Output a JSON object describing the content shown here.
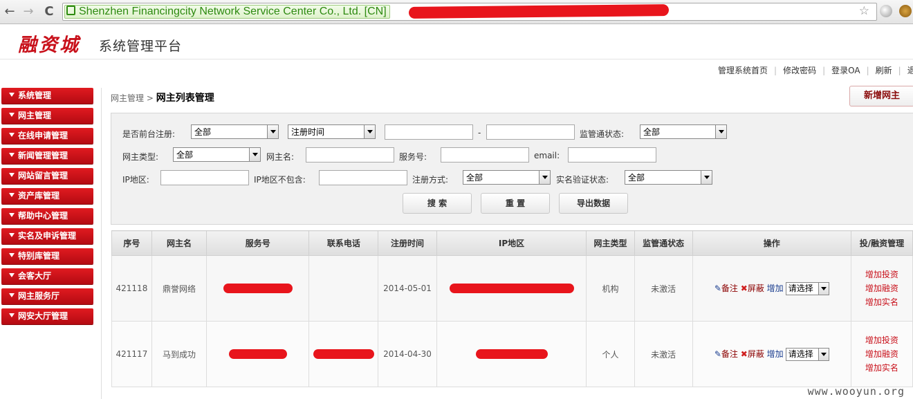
{
  "browser": {
    "ev_label": "Shenzhen Financingcity Network Service Center Co., Ltd. [CN]",
    "back_icon": "←",
    "forward_icon": "→",
    "reload_icon": "C",
    "star_icon": "☆"
  },
  "header": {
    "logo": "融资城",
    "system_title": "系统管理平台"
  },
  "topnav": {
    "links": [
      "管理系统首页",
      "修改密码",
      "登录OA",
      "刷新",
      "退"
    ]
  },
  "sidebar": {
    "items": [
      "系统管理",
      "网主管理",
      "在线申请管理",
      "新闻管理管理",
      "网站留言管理",
      "资产库管理",
      "帮助中心管理",
      "实名及申诉管理",
      "特别库管理",
      "会客大厅",
      "网主服务厅",
      "网安大厅管理"
    ]
  },
  "breadcrumb": {
    "parent": "网主管理",
    "separator": ">",
    "current": "网主列表管理"
  },
  "add_button": "新增网主",
  "filters": {
    "front_register_label": "是否前台注册:",
    "front_register_value": "全部",
    "date_type_value": "注册时间",
    "date_sep": "-",
    "supervision_label": "监管通状态:",
    "supervision_value": "全部",
    "owner_type_label": "网主类型:",
    "owner_type_value": "全部",
    "owner_name_label": "网主名:",
    "service_no_label": "服务号:",
    "email_label": "email:",
    "ip_region_label": "IP地区:",
    "ip_exclude_label": "IP地区不包含:",
    "register_method_label": "注册方式:",
    "register_method_value": "全部",
    "realname_label": "实名验证状态:",
    "realname_value": "全部",
    "search_button": "搜 索",
    "reset_button": "重 置",
    "export_button": "导出数据"
  },
  "table": {
    "headers": [
      "序号",
      "网主名",
      "服务号",
      "联系电话",
      "注册时间",
      "IP地区",
      "网主类型",
      "监管通状态",
      "操作",
      "投/融资管理"
    ],
    "rows": [
      {
        "id": "421118",
        "name": "鼎誉网络",
        "date": "2014-05-01",
        "type": "机构",
        "status": "未激活"
      },
      {
        "id": "421117",
        "name": "马到成功",
        "date": "2014-04-30",
        "type": "个人",
        "status": "未激活"
      }
    ],
    "ops": {
      "note": "备注",
      "block": "屏蔽",
      "add": "增加",
      "select": "请选择"
    },
    "fund_links": [
      "增加投资",
      "增加融资",
      "增加实名"
    ]
  },
  "watermark": "www.wooyun.org"
}
